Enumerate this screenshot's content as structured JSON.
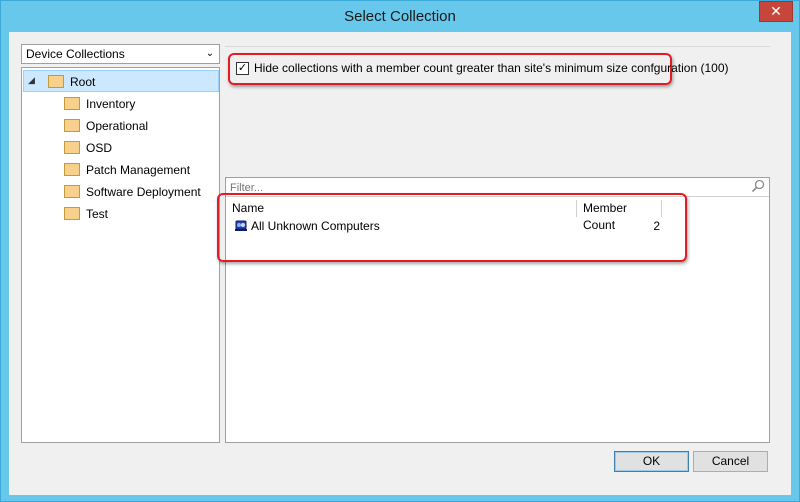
{
  "window": {
    "title": "Select Collection",
    "close_label": "✕"
  },
  "left_panel": {
    "collection_type": "Device Collections",
    "tree": {
      "root": "Root",
      "children": [
        "Inventory",
        "Operational",
        "OSD",
        "Patch Management",
        "Software Deployment",
        "Test"
      ]
    }
  },
  "options": {
    "hide_small_checked": true,
    "hide_small_label": "Hide collections with a member count greater than site's minimum size confguration (100)"
  },
  "grid": {
    "filter_placeholder": "Filter...",
    "columns": [
      "Name",
      "Member Count"
    ],
    "rows": [
      {
        "name": "All Unknown Computers",
        "member_count": "2"
      }
    ]
  },
  "buttons": {
    "ok": "OK",
    "cancel": "Cancel"
  },
  "colors": {
    "title_bar": "#67c8ec",
    "highlight": "#e31b23",
    "selection": "#cce8ff"
  }
}
